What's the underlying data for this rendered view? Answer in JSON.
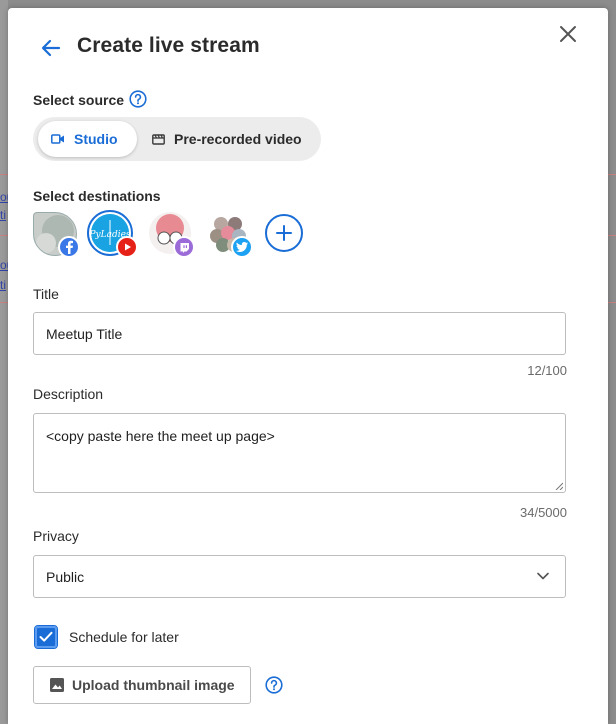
{
  "dialog": {
    "title": "Create live stream"
  },
  "background": {
    "snippets": [
      "ou",
      "ti",
      "ou",
      "ti"
    ]
  },
  "source": {
    "label": "Select source",
    "options": [
      {
        "label": "Studio",
        "icon": "video-camera-icon",
        "selected": true
      },
      {
        "label": "Pre-recorded video",
        "icon": "film-icon",
        "selected": false
      }
    ]
  },
  "destinations": {
    "label": "Select destinations",
    "items": [
      {
        "platform": "facebook-icon",
        "selected": false
      },
      {
        "platform": "youtube-icon",
        "selected": true
      },
      {
        "platform": "twitch-icon",
        "selected": false
      },
      {
        "platform": "twitter-icon",
        "selected": false
      }
    ],
    "avatar_text": "PyLadies"
  },
  "title_field": {
    "label": "Title",
    "value": "Meetup Title",
    "counter": "12/100"
  },
  "description_field": {
    "label": "Description",
    "value": "<copy paste here the meet up page>",
    "counter": "34/5000"
  },
  "privacy": {
    "label": "Privacy",
    "value": "Public"
  },
  "schedule": {
    "label": "Schedule for later",
    "checked": true
  },
  "upload": {
    "label": "Upload thumbnail image"
  },
  "colors": {
    "accent": "#1a6dd6",
    "facebook": "#3b78e7",
    "youtube": "#e62117",
    "twitch": "#9b6bd8",
    "twitter": "#1da1f2"
  }
}
